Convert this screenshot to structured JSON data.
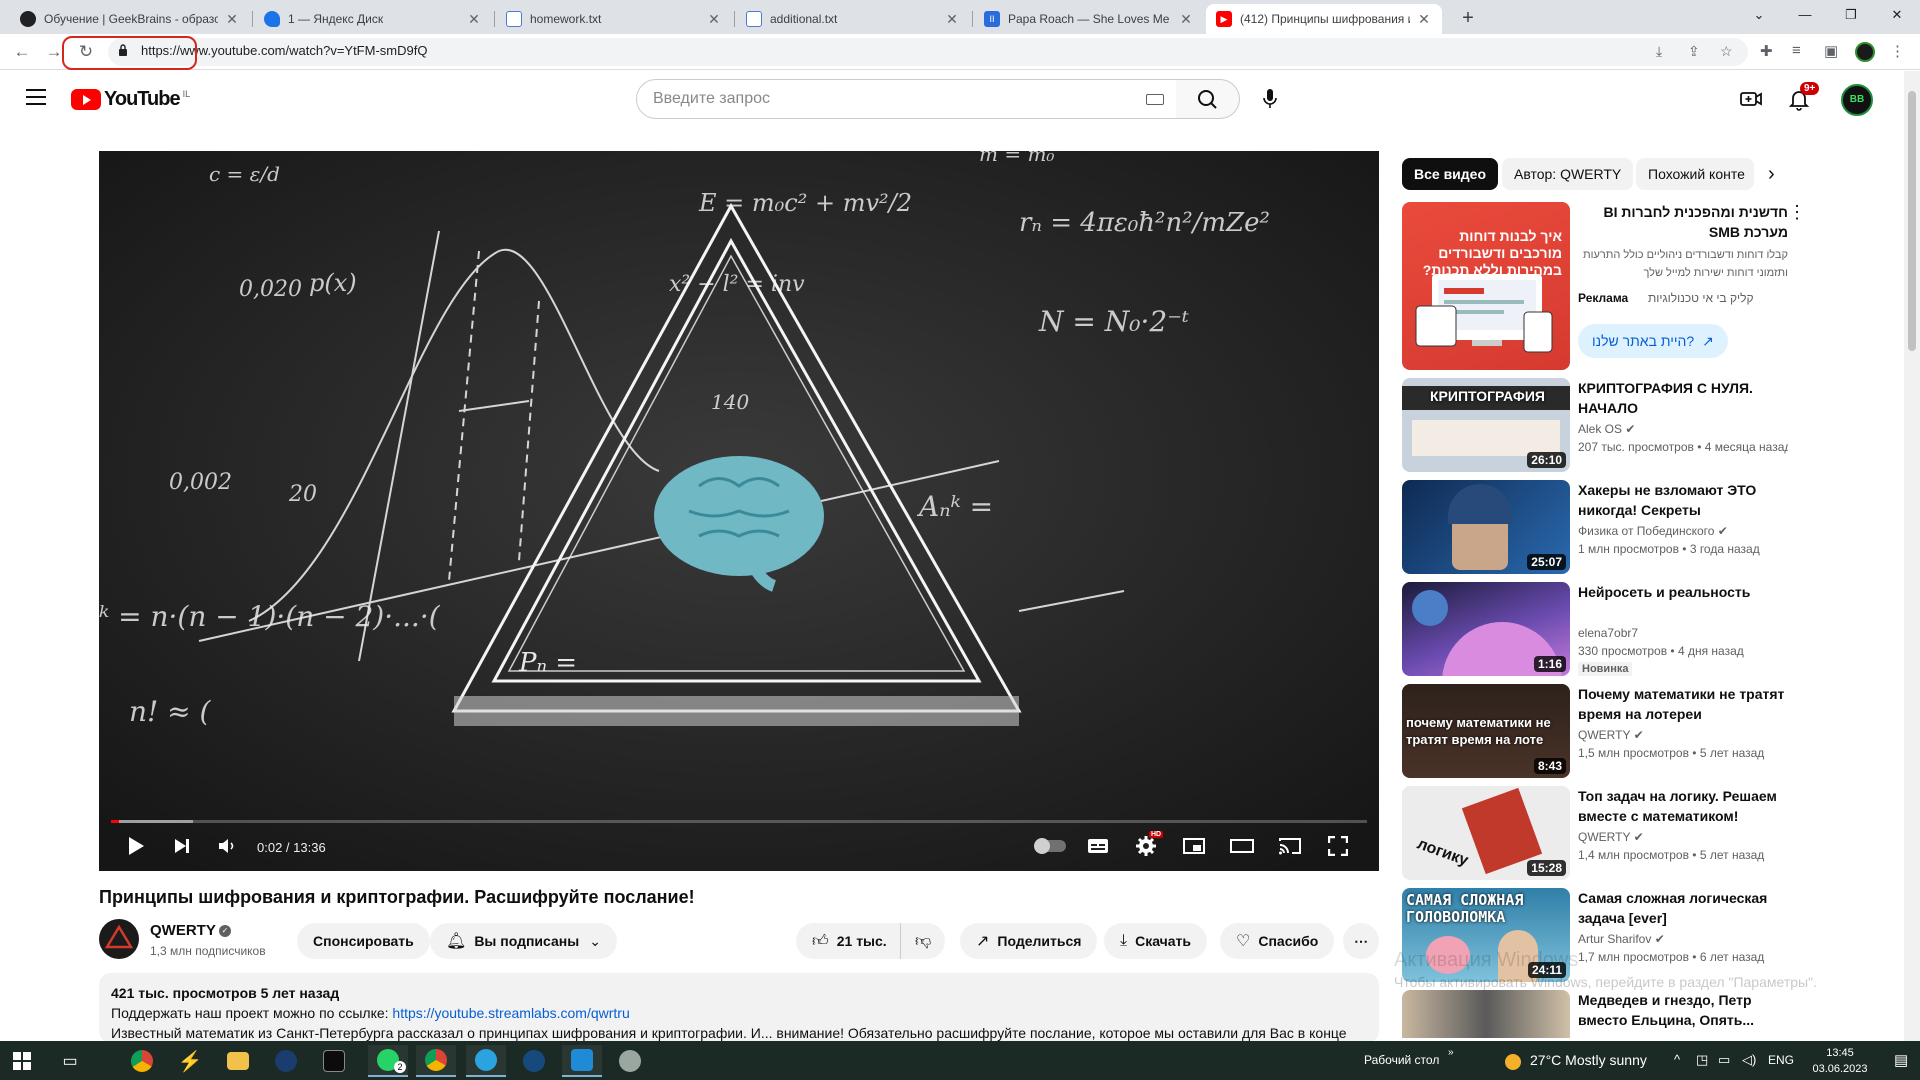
{
  "browser": {
    "tabs": [
      {
        "title": "Обучение | GeekBrains - образо",
        "favicon_color": "#202124"
      },
      {
        "title": "1 — Яндекс Диск",
        "favicon_color": "#1a73e8"
      },
      {
        "title": "homework.txt",
        "favicon_color": "#4a7bd0"
      },
      {
        "title": "additional.txt",
        "favicon_color": "#4a7bd0"
      },
      {
        "title": "Papa Roach — She Loves Me Not",
        "favicon_color": "#2b6bdb"
      },
      {
        "title": "(412) Принципы шифрования и",
        "favicon_color": "#ff0000"
      }
    ],
    "new_tab": "+",
    "url": "https://www.youtube.com/watch?v=YtFM-smD9fQ"
  },
  "youtube": {
    "logo_text": "YouTube",
    "country_code": "IL",
    "search_placeholder": "Введите запрос",
    "notification_count": "9+",
    "avatar_initials": "BB"
  },
  "player": {
    "time_current": "0:02",
    "time_total": "13:36",
    "progress_fraction": 0.006,
    "buffered_fraction": 0.065,
    "hd_badge": "HD"
  },
  "video": {
    "title": "Принципы шифрования и криптографии. Расшифруйте послание!",
    "channel": "QWERTY",
    "subscribers": "1,3 млн подписчиков",
    "sponsor_label": "Спонсировать",
    "subscribed_label": "Вы подписаны",
    "likes": "21 тыс.",
    "share_label": "Поделиться",
    "download_label": "Скачать",
    "thanks_label": "Спасибо",
    "views_and_date": "421 тыс. просмотров  5 лет назад",
    "desc_line1_prefix": "Поддержать наш проект можно по ссылке: ",
    "desc_link": "https://youtube.streamlabs.com/qwrtru",
    "desc_line2": "Известный математик из Санкт-Петербурга рассказал о принципах шифрования и криптографии. И... внимание! Обязательно расшифруйте послание, которое мы оставили для Вас в конце"
  },
  "sidebar": {
    "chips": [
      "Все видео",
      "Автор: QWERTY",
      "Похожий конте"
    ],
    "ad": {
      "title": "חדשנית ומהפכנית לחברות BI מערכת SMB",
      "desc": "קבלו דוחות ודשבורדים ניהוליים כולל התרעות ותזמוני דוחות ישירות למייל שלך",
      "badge": "Реклама",
      "advertiser": "קליק בי אי טכנולוגיות",
      "cta": "?היית באתר שלנו",
      "thumb_text": "איך לבנות דוחות מורכבים ודשבורדים במהירות וללא תכנות?"
    },
    "recs": [
      {
        "title": "КРИПТОГРАФИЯ С НУЛЯ. НАЧАЛО",
        "channel": "Alek OS",
        "meta": "207 тыс. просмотров • 4 месяца назад",
        "duration": "26:10",
        "thumb_text": "КРИПТОГРАФИЯ",
        "color": "#c8d2dc"
      },
      {
        "title": "Хакеры не взломают ЭТО никогда! Секреты квантовой...",
        "channel": "Физика от Побединского",
        "meta": "1 млн просмотров • 3 года назад",
        "duration": "25:07",
        "thumb_text": "",
        "color": "#123a6a"
      },
      {
        "title": "Нейросеть и реальность",
        "channel": "elena7obr7",
        "meta": "330 просмотров • 4 дня назад",
        "duration": "1:16",
        "badge": "Новинка",
        "thumb_text": "",
        "color": "#4b3a8c"
      },
      {
        "title": "Почему математики не тратят время на лотереи",
        "channel": "QWERTY",
        "meta": "1,5 млн просмотров • 5 лет назад",
        "duration": "8:43",
        "thumb_text": "почему математики не тратят время на лоте",
        "color": "#3a2a24"
      },
      {
        "title": "Топ задач на логику. Решаем вместе с математиком!",
        "channel": "QWERTY",
        "meta": "1,4 млн просмотров • 5 лет назад",
        "duration": "15:28",
        "thumb_text": "логику",
        "color": "#e8e8e8"
      },
      {
        "title": "Самая сложная логическая задача [ever]",
        "channel": "Artur Sharifov",
        "meta": "1,7 млн просмотров • 6 лет назад",
        "duration": "24:11",
        "thumb_text": "САМАЯ СЛОЖНАЯ ГОЛОВОЛОМКА",
        "color": "#3d8fb8"
      },
      {
        "title": "Медведев и гнездо, Петр вместо Ельцина, Опять...",
        "channel": "",
        "meta": "",
        "duration": "",
        "thumb_text": "",
        "color": "#5a5a5a"
      }
    ]
  },
  "watermark": {
    "line1": "Активация Windows",
    "line2": "Чтобы активировать Windows, перейдите в раздел \"Параметры\"."
  },
  "taskbar": {
    "desktop_label": "Рабочий стол",
    "weather": "27°C  Mostly sunny",
    "lang": "ENG",
    "time": "13:45",
    "date": "03.06.2023",
    "whatsapp_badge": "2",
    "chrome_badge": "2"
  },
  "colors": {
    "yt_red": "#ff0000",
    "annotation_red": "#d7261e",
    "link_blue": "#065fd4"
  }
}
